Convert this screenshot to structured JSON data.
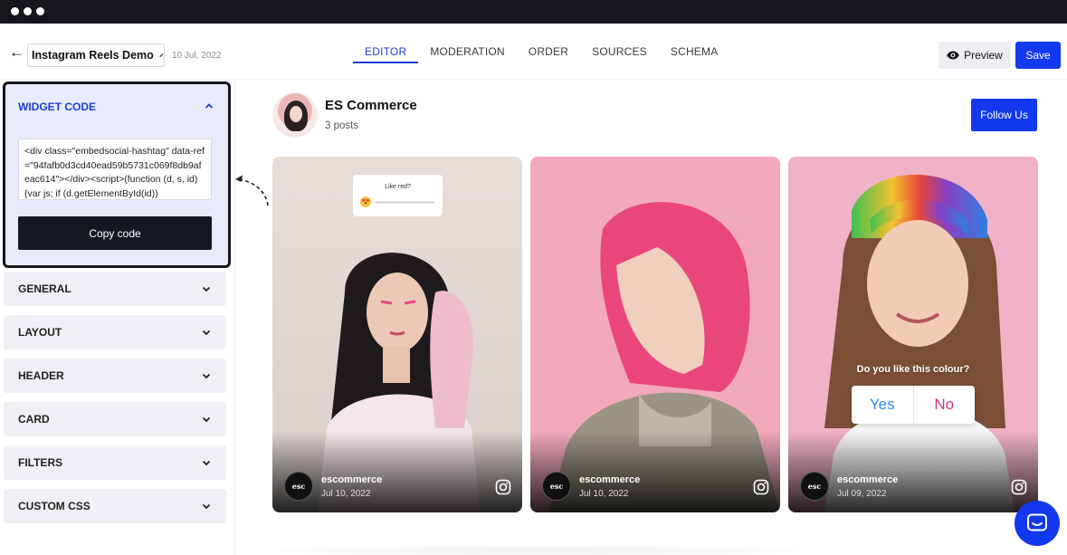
{
  "header": {
    "widget_name": "Instagram Reels Demo",
    "date": "10 Jul, 2022",
    "tabs": [
      {
        "label": "EDITOR",
        "active": true
      },
      {
        "label": "MODERATION",
        "active": false
      },
      {
        "label": "ORDER",
        "active": false
      },
      {
        "label": "SOURCES",
        "active": false
      },
      {
        "label": "SCHEMA",
        "active": false
      }
    ],
    "preview_label": "Preview",
    "save_label": "Save"
  },
  "sidebar": {
    "widget_code": {
      "title": "WIDGET CODE",
      "code": "<div class=\"embedsocial-hashtag\" data-ref=\"94fafb0d3cd40ead59b5731c069f8db9afeac614\"></div><script>(function (d, s, id){var js; if (d.getElementById(id))",
      "copy_label": "Copy code"
    },
    "sections": [
      "GENERAL",
      "LAYOUT",
      "HEADER",
      "CARD",
      "FILTERS",
      "CUSTOM CSS"
    ]
  },
  "profile": {
    "name": "ES Commerce",
    "posts": "3 posts",
    "follow_label": "Follow Us"
  },
  "cards": [
    {
      "username": "escommerce",
      "date": "Jul 10, 2022",
      "logo_text": "esc",
      "sticker": {
        "question": "Like red?",
        "emoji": "😍"
      }
    },
    {
      "username": "escommerce",
      "date": "Jul 10, 2022",
      "logo_text": "esc"
    },
    {
      "username": "escommerce",
      "date": "Jul 09, 2022",
      "logo_text": "esc",
      "poll": {
        "question": "Do you like this colour?",
        "yes": "Yes",
        "no": "No"
      }
    }
  ],
  "colors": {
    "accent": "#1238f0",
    "active_tab": "#1f3fd6",
    "panel_bg": "#e8ebfb",
    "dark_button": "#151822"
  },
  "icons": {
    "back": "arrow-left-icon",
    "edit": "pencil-icon",
    "preview": "eye-icon",
    "collapse": "chevron-up-icon",
    "expand": "chevron-down-icon",
    "instagram": "instagram-icon",
    "chat": "chat-icon"
  }
}
